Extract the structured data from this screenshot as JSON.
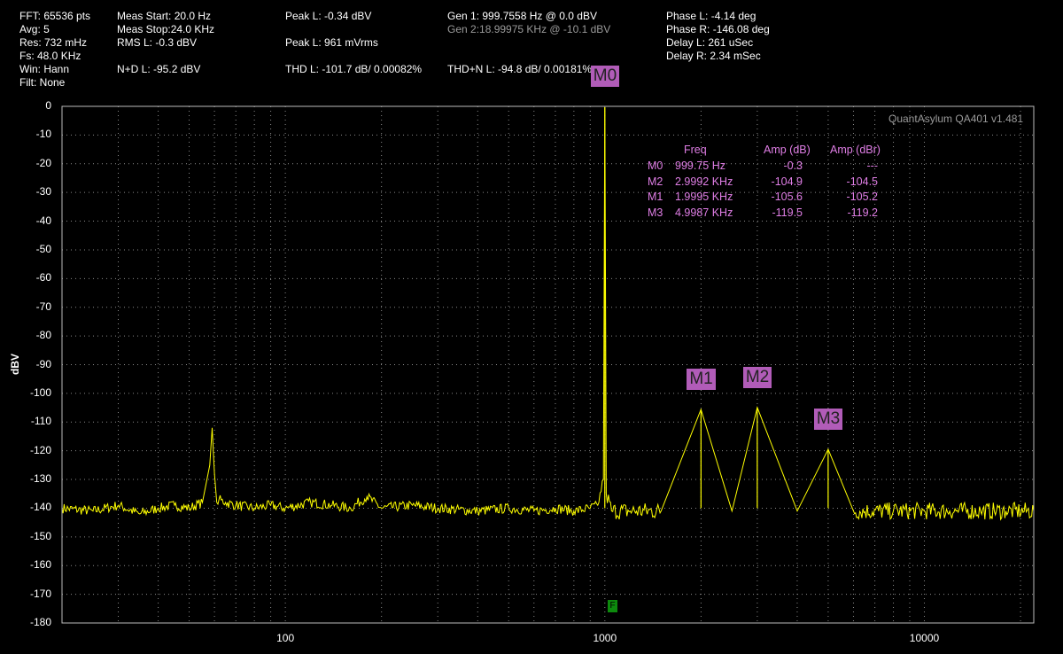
{
  "header": {
    "fft": "FFT: 65536 pts",
    "avg": "Avg: 5",
    "res": "Res: 732 mHz",
    "fs": "Fs: 48.0 KHz",
    "win": "Win: Hann",
    "filt": "Filt: None",
    "meas_start": "Meas Start: 20.0 Hz",
    "meas_stop": "Meas Stop:24.0 KHz",
    "rms_l": "RMS L: -0.3 dBV",
    "nd_l": "N+D L: -95.2 dBV",
    "peak_l_dbv": "Peak L: -0.34 dBV",
    "peak_l_mv": "Peak L: 961 mVrms",
    "thd_l": "THD L: -101.7 dB/ 0.00082%",
    "gen1": "Gen 1: 999.7558 Hz @ 0.0  dBV",
    "gen2": "Gen 2:18.99975 KHz @ -10.1  dBV",
    "thdn_l": "THD+N L: -94.8 dB/ 0.00181%",
    "phase_l": "Phase L: -4.14 deg",
    "phase_r": "Phase R: -146.08 deg",
    "delay_l": "Delay L: 261 uSec",
    "delay_r": "Delay R: 2.34 mSec"
  },
  "watermark": "QuantAsylum QA401 v1.481",
  "marker_table": {
    "headers": [
      "Freq",
      "Amp (dB)",
      "Amp (dBr)"
    ],
    "rows": [
      {
        "marker": "M0",
        "freq": "999.75 Hz",
        "amp_db": "-0.3",
        "amp_dbr": "---"
      },
      {
        "marker": "M2",
        "freq": "2.9992 KHz",
        "amp_db": "-104.9",
        "amp_dbr": "-104.5"
      },
      {
        "marker": "M1",
        "freq": "1.9995 KHz",
        "amp_db": "-105.6",
        "amp_dbr": "-105.2"
      },
      {
        "marker": "M3",
        "freq": "4.9987 KHz",
        "amp_db": "-119.5",
        "amp_dbr": "-119.2"
      }
    ]
  },
  "markers": [
    {
      "label": "M0",
      "freq": 999.75,
      "amp": -0.3
    },
    {
      "label": "M1",
      "freq": 1999.5,
      "amp": -105.6
    },
    {
      "label": "M2",
      "freq": 2999.2,
      "amp": -104.9
    },
    {
      "label": "M3",
      "freq": 4998.7,
      "amp": -119.5
    }
  ],
  "f_flag": "F",
  "colors": {
    "trace": "#ffff00",
    "marker_bg": "#b15cb8",
    "marker_text": "#e07ee6",
    "grid": "#8a8a8a"
  },
  "chart_data": {
    "type": "line",
    "title": "",
    "xlabel": "",
    "ylabel": "dBV",
    "x_scale": "log",
    "xlim": [
      20,
      22000
    ],
    "ylim": [
      -180,
      0
    ],
    "x_ticks": [
      100,
      1000,
      10000
    ],
    "x_tick_labels": [
      "100",
      "1000",
      "10000"
    ],
    "y_ticks": [
      0,
      -10,
      -20,
      -30,
      -40,
      -50,
      -60,
      -70,
      -80,
      -90,
      -100,
      -110,
      -120,
      -130,
      -140,
      -150,
      -160,
      -170,
      -180
    ],
    "grid": true,
    "series": [
      {
        "values_description_x": [
          20,
          25,
          30,
          35,
          40,
          45,
          50,
          55,
          58,
          59,
          60,
          61,
          62,
          65,
          70,
          80,
          90,
          100,
          120,
          140,
          160,
          180,
          200,
          250,
          300,
          400,
          500,
          600,
          700,
          800,
          900,
          950,
          990,
          999.75,
          1010,
          1050,
          1200,
          1500,
          1999.5,
          2500,
          2999.2,
          4000,
          4998.7,
          6000,
          8000,
          10000,
          12000,
          15000,
          18000,
          22000
        ],
        "y": [
          -140,
          -141,
          -139,
          -142,
          -140,
          -139,
          -140,
          -138,
          -125,
          -112,
          -128,
          -138,
          -137,
          -138,
          -139,
          -140,
          -139,
          -140,
          -138,
          -139,
          -140,
          -136,
          -140,
          -139,
          -140,
          -141,
          -140,
          -141,
          -140,
          -141,
          -140,
          -139,
          -130,
          -0.3,
          -135,
          -141,
          -141,
          -141,
          -105.6,
          -141,
          -104.9,
          -141,
          -119.5,
          -141,
          -141,
          -141,
          -141,
          -141,
          -141,
          -141
        ]
      }
    ]
  }
}
